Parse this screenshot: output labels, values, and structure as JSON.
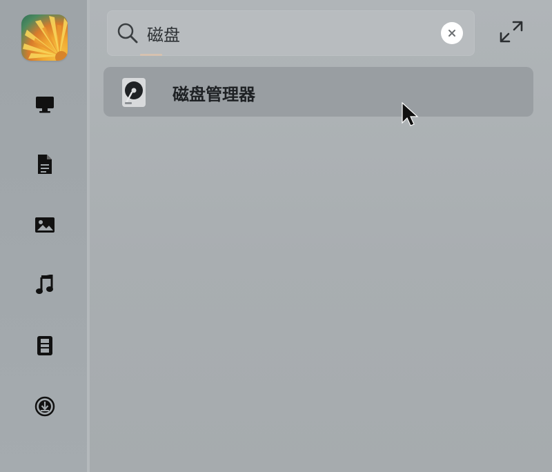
{
  "search": {
    "query": "磁盘"
  },
  "results": [
    {
      "label": "磁盘管理器",
      "icon": "disk-manager-icon"
    }
  ],
  "sidebar": {
    "items": [
      {
        "icon": "computer-icon"
      },
      {
        "icon": "document-icon"
      },
      {
        "icon": "image-icon"
      },
      {
        "icon": "music-icon"
      },
      {
        "icon": "video-icon"
      },
      {
        "icon": "download-icon"
      }
    ]
  },
  "icons": {
    "search": "search-icon",
    "clear": "clear-icon",
    "expand": "expand-icon"
  },
  "colors": {
    "sidebar_background": "#a2a8ac",
    "main_background": "#aaafb2",
    "search_box": "#b8bcbf",
    "result_highlight": "#999ea2",
    "text": "#1e2124"
  }
}
